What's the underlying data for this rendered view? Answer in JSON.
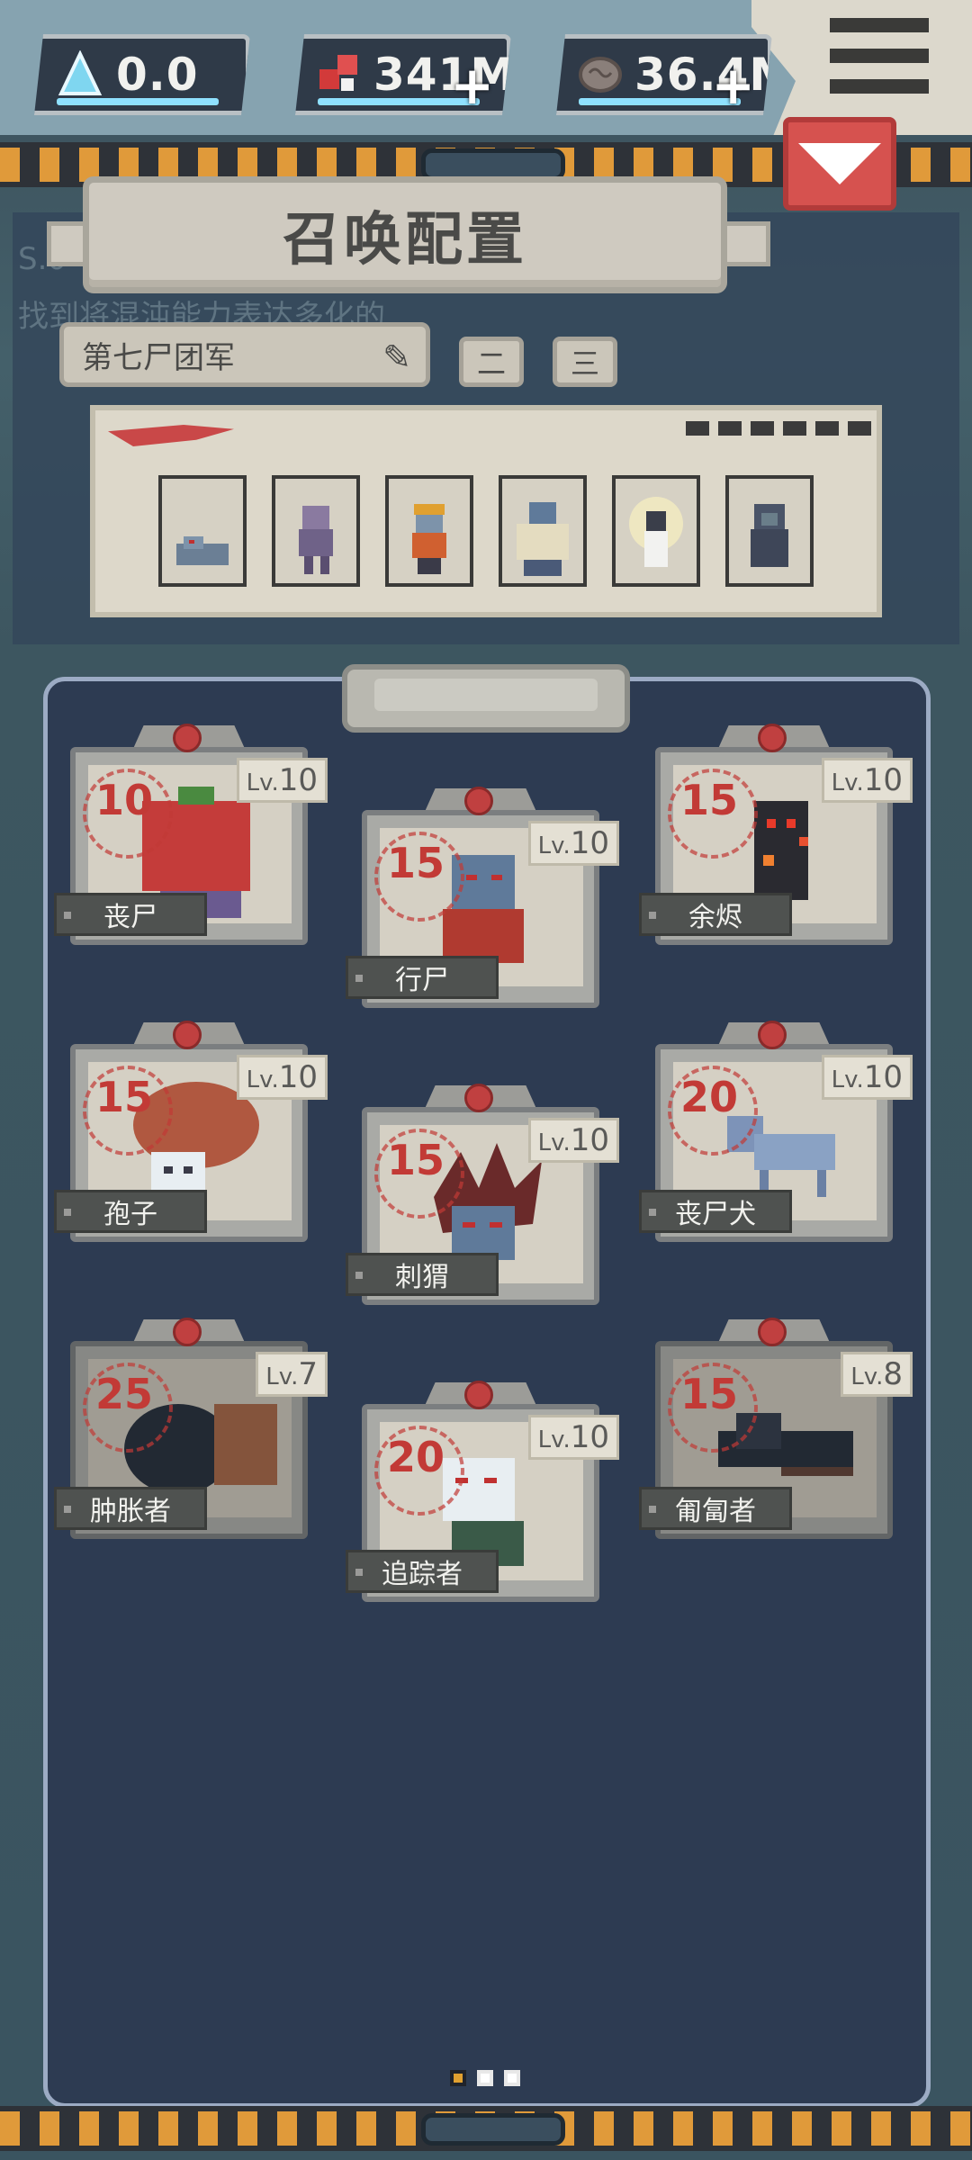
{
  "resources": [
    {
      "icon": "crystal-icon",
      "value": "0.0",
      "has_plus": false
    },
    {
      "icon": "flesh-icon",
      "value": "341M",
      "has_plus": true
    },
    {
      "icon": "brain-icon",
      "value": "36.4M",
      "has_plus": true
    }
  ],
  "panel": {
    "title": "召唤配置",
    "ghost_text_1": "S.0",
    "ghost_text_2": "找到将混沌能力表达多化的"
  },
  "team": {
    "name": "第七尸团军",
    "tab_2": "二",
    "tab_3": "三"
  },
  "roster_slots": [
    "rat-zombie",
    "purple-ghoul",
    "hardhat-worker",
    "fat-brute",
    "glowing-child",
    "hooded-zombie"
  ],
  "units": [
    {
      "name": "丧尸",
      "cost": "10",
      "level_prefix": "Lv.",
      "level": "10"
    },
    {
      "name": "行尸",
      "cost": "15",
      "level_prefix": "Lv.",
      "level": "10"
    },
    {
      "name": "余烬",
      "cost": "15",
      "level_prefix": "Lv.",
      "level": "10"
    },
    {
      "name": "孢子",
      "cost": "15",
      "level_prefix": "Lv.",
      "level": "10"
    },
    {
      "name": "刺猬",
      "cost": "15",
      "level_prefix": "Lv.",
      "level": "10"
    },
    {
      "name": "丧尸犬",
      "cost": "20",
      "level_prefix": "Lv.",
      "level": "10"
    },
    {
      "name": "肿胀者",
      "cost": "25",
      "level_prefix": "Lv.",
      "level": "7"
    },
    {
      "name": "追踪者",
      "cost": "20",
      "level_prefix": "Lv.",
      "level": "10"
    },
    {
      "name": "匍匐者",
      "cost": "15",
      "level_prefix": "Lv.",
      "level": "8"
    }
  ],
  "pagination": {
    "pages": 3,
    "current": 1
  },
  "colors": {
    "accent_red": "#d6524f",
    "stripe_orange": "#e09a3a",
    "board": "#2d3b52"
  }
}
